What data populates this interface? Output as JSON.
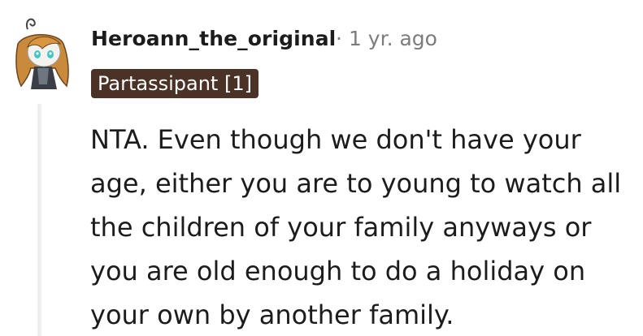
{
  "comment": {
    "author": "Heroann_the_original",
    "separator": "·",
    "timestamp": "1 yr. ago",
    "flair": "Partassipant [1]",
    "body_lines": [
      "NTA. Even though we don't have your",
      "age, either you are to young to watch all",
      "the children of your family anyways or",
      "you are old enough to do a holiday on",
      "your own by another family."
    ],
    "avatar_icon": "user-avatar",
    "colors": {
      "flair_bg": "#4a3326",
      "meta_text": "#7c7c7c",
      "thread_line": "#edeff1"
    }
  }
}
